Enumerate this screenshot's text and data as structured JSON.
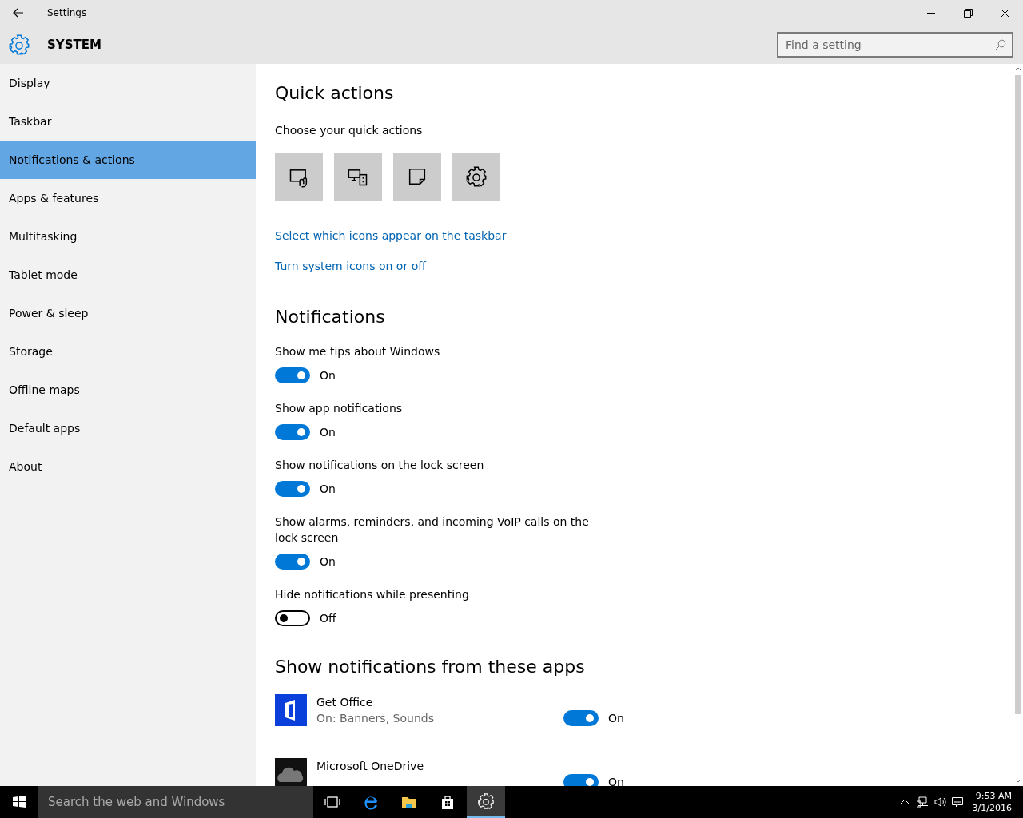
{
  "window": {
    "title": "Settings",
    "section": "SYSTEM"
  },
  "search": {
    "placeholder": "Find a setting"
  },
  "sidebar": {
    "items": [
      {
        "label": "Display",
        "selected": false
      },
      {
        "label": "Taskbar",
        "selected": false
      },
      {
        "label": "Notifications & actions",
        "selected": true
      },
      {
        "label": "Apps & features",
        "selected": false
      },
      {
        "label": "Multitasking",
        "selected": false
      },
      {
        "label": "Tablet mode",
        "selected": false
      },
      {
        "label": "Power & sleep",
        "selected": false
      },
      {
        "label": "Storage",
        "selected": false
      },
      {
        "label": "Offline maps",
        "selected": false
      },
      {
        "label": "Default apps",
        "selected": false
      },
      {
        "label": "About",
        "selected": false
      }
    ]
  },
  "quick_actions": {
    "heading": "Quick actions",
    "subheading": "Choose your quick actions",
    "links": [
      "Select which icons appear on the taskbar",
      "Turn system icons on or off"
    ]
  },
  "notifications": {
    "heading": "Notifications",
    "settings": [
      {
        "label": "Show me tips about Windows",
        "on": true,
        "state": "On"
      },
      {
        "label": "Show app notifications",
        "on": true,
        "state": "On"
      },
      {
        "label": "Show notifications on the lock screen",
        "on": true,
        "state": "On"
      },
      {
        "label": "Show alarms, reminders, and incoming VoIP calls on the lock screen",
        "on": true,
        "state": "On"
      },
      {
        "label": "Hide notifications while presenting",
        "on": false,
        "state": "Off"
      }
    ]
  },
  "apps": {
    "heading": "Show notifications from these apps",
    "items": [
      {
        "name": "Get Office",
        "detail": "On: Banners, Sounds",
        "on": true,
        "state": "On"
      },
      {
        "name": "Microsoft OneDrive",
        "on": true,
        "state": "On"
      }
    ]
  },
  "taskbar": {
    "search_placeholder": "Search the web and Windows",
    "time": "9:53 AM",
    "date": "3/1/2016"
  }
}
